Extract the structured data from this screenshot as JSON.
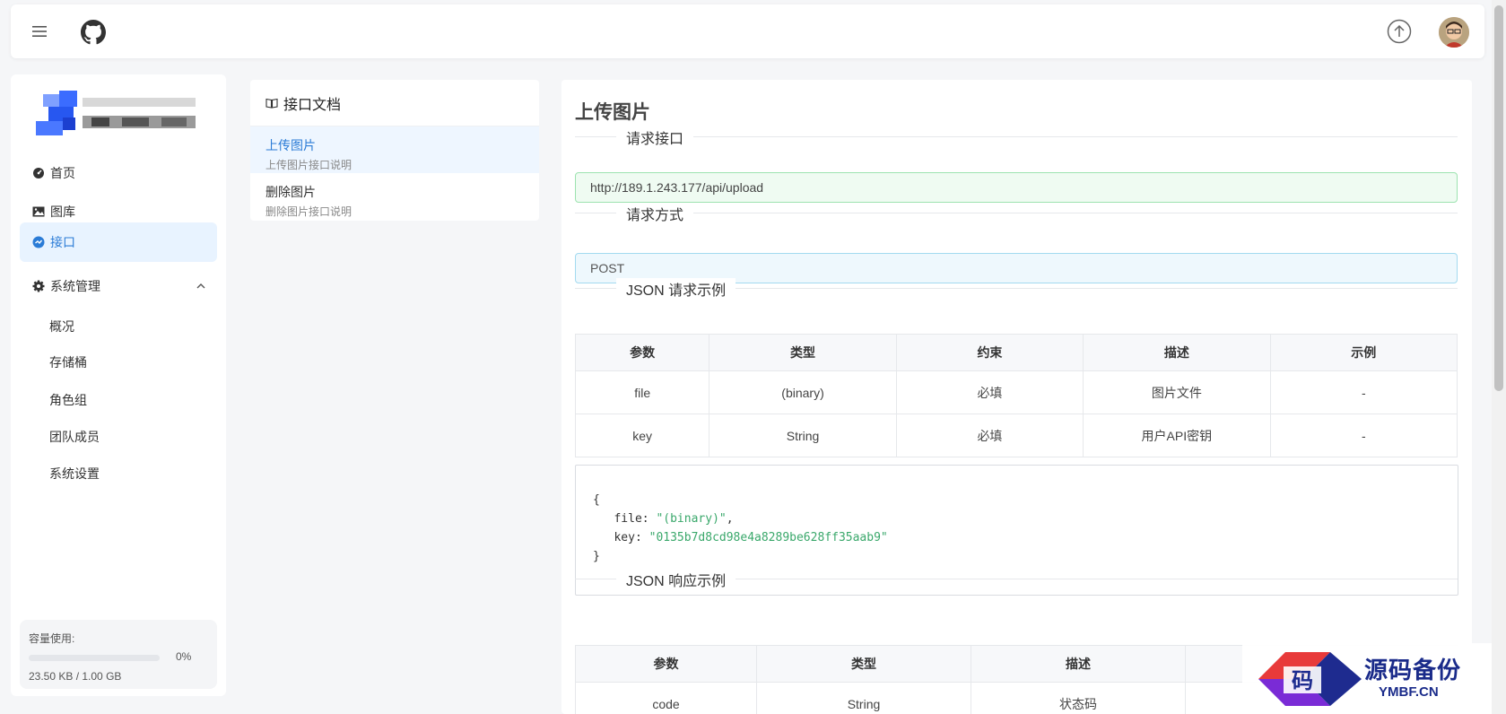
{
  "header": {
    "menu_icon": "hamburger-menu-icon",
    "github_icon": "github-icon",
    "upload_icon": "arrow-up-circle-icon",
    "avatar_icon": "user-avatar"
  },
  "sidebar": {
    "nav": [
      {
        "label": "首页",
        "icon": "dashboard-icon"
      },
      {
        "label": "图库",
        "icon": "image-icon"
      },
      {
        "label": "接口",
        "icon": "api-icon",
        "active": true
      },
      {
        "label": "系统管理",
        "icon": "gear-icon"
      }
    ],
    "sub_items": [
      "概况",
      "存储桶",
      "角色组",
      "团队成员",
      "系统设置"
    ],
    "storage": {
      "label": "容量使用:",
      "percent": "0%",
      "fraction": 0,
      "size": "23.50 KB / 1.00 GB"
    }
  },
  "docs": {
    "title": "接口文档",
    "items": [
      {
        "title": "上传图片",
        "desc": "上传图片接口说明",
        "active": true
      },
      {
        "title": "删除图片",
        "desc": "删除图片接口说明"
      }
    ]
  },
  "main": {
    "title": "上传图片",
    "section_endpoint": "请求接口",
    "endpoint": "http://189.1.243.177/api/upload",
    "section_method": "请求方式",
    "method": "POST",
    "section_request": "JSON 请求示例",
    "request_table": {
      "headers": [
        "参数",
        "类型",
        "约束",
        "描述",
        "示例"
      ],
      "rows": [
        [
          "file",
          "(binary)",
          "必填",
          "图片文件",
          "-"
        ],
        [
          "key",
          "String",
          "必填",
          "用户API密钥",
          "-"
        ]
      ]
    },
    "code": {
      "open": "{",
      "file_key": "file",
      "file_val": "\"(binary)\"",
      "key_key": "key",
      "key_val": "\"0135b7d8cd98e4a8289be628ff35aab9\"",
      "close": "}"
    },
    "section_response": "JSON 响应示例",
    "response_table": {
      "headers": [
        "参数",
        "类型",
        "描述",
        ""
      ],
      "rows": [
        [
          "code",
          "String",
          "状态码",
          ""
        ]
      ]
    }
  },
  "watermark": {
    "cn": "源码备份",
    "en": "YMBF.CN"
  },
  "colors": {
    "accent": "#2a7bd6",
    "endpoint_bg": "#effbf2",
    "method_bg": "#eef8fd"
  }
}
